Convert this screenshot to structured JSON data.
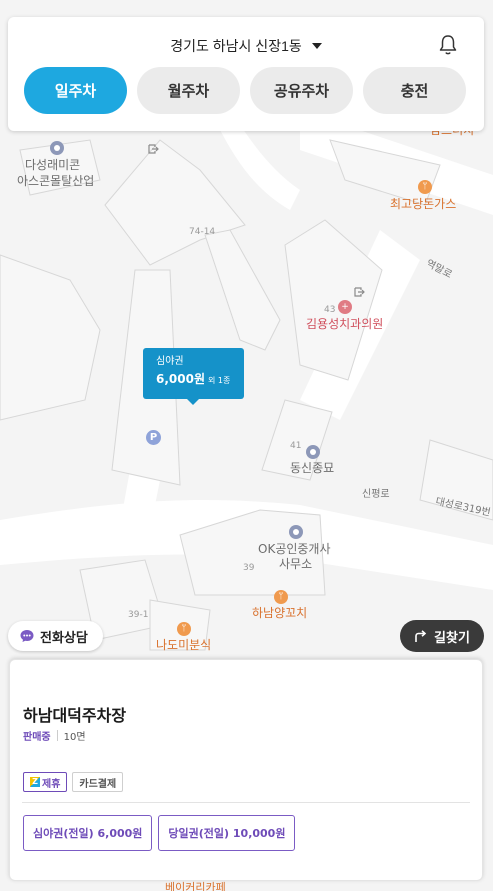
{
  "header": {
    "location": "경기도 하남시 신장1동",
    "tabs": [
      {
        "label": "일주차",
        "active": true
      },
      {
        "label": "월주차",
        "active": false
      },
      {
        "label": "공유주차",
        "active": false
      },
      {
        "label": "충전",
        "active": false
      }
    ]
  },
  "map": {
    "labels": {
      "poi_1": "다성래미콘",
      "poi_1b": "아스콘몰탈산업",
      "poi_2": "최고당돈가스",
      "poi_3": "김용성치과의원",
      "poi_4": "동신종묘",
      "poi_5": "OK공인중개사",
      "poi_5b": "사무소",
      "poi_6": "하남양꼬치",
      "poi_7": "나도미분식",
      "poi_top_right": "맘스터치",
      "road_1": "역말로",
      "road_2": "신평로",
      "road_3": "대성로319번",
      "lot_74_14": "74-14",
      "lot_43": "43",
      "lot_41": "41",
      "lot_39": "39",
      "lot_39_1": "39-1",
      "bottom_peek": "베이커리카페"
    },
    "price_marker": {
      "type": "심야권",
      "price": "6,000원",
      "extra": "외 1종"
    },
    "parking_pin": "P"
  },
  "buttons": {
    "consult": "전화상담",
    "route": "길찾기"
  },
  "lot": {
    "name": "하남대덕주차장",
    "status": "판매중",
    "spaces": "10면",
    "tags": [
      "제휴",
      "카드결제"
    ],
    "prices": [
      "심야권(전일) 6,000원",
      "당일권(전일) 10,000원"
    ]
  },
  "colors": {
    "accent": "#1ea8e0",
    "marker": "#1592c9",
    "purple": "#6e4bb8",
    "dark_button": "#3a3a3a"
  }
}
